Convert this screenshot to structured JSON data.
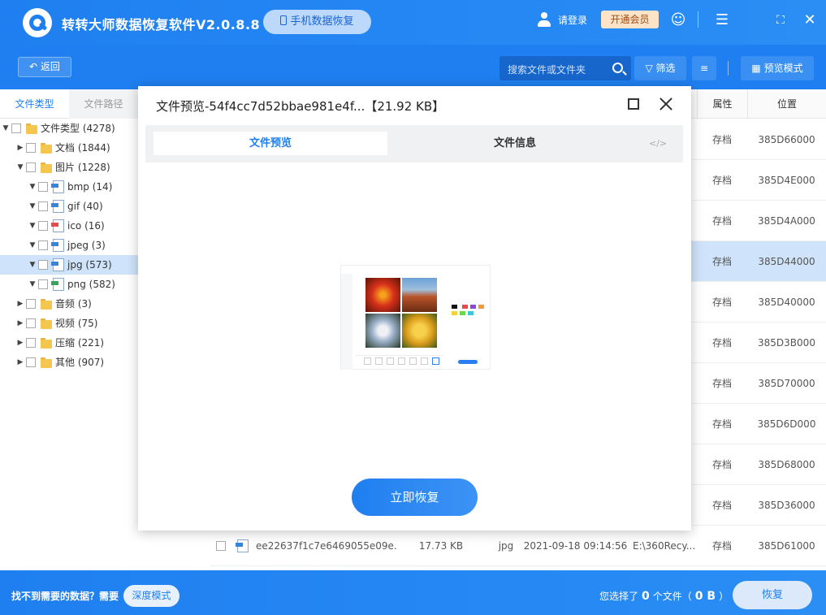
{
  "header": {
    "app_title": "转转大师数据恢复软件V2.0.8.8",
    "mobile_recovery": "手机数据恢复",
    "login": "请登录",
    "vip": "开通会员"
  },
  "toolbar": {
    "back": "返回",
    "search_placeholder": "搜索文件或文件夹",
    "filter": "筛选",
    "preview_mode": "预览模式"
  },
  "left_tabs": {
    "file_type": "文件类型",
    "file_path": "文件路径"
  },
  "tree": [
    {
      "label": "文件类型 (4278)",
      "level": 0,
      "icon": "folder",
      "expanded": true
    },
    {
      "label": "文档 (1844)",
      "level": 1,
      "icon": "folder",
      "expanded": false
    },
    {
      "label": "图片 (1228)",
      "level": 1,
      "icon": "folder",
      "expanded": true
    },
    {
      "label": "bmp (14)",
      "level": 2,
      "icon": "file-blue",
      "expanded": true
    },
    {
      "label": "gif (40)",
      "level": 2,
      "icon": "file-blue",
      "expanded": true
    },
    {
      "label": "ico (16)",
      "level": 2,
      "icon": "file-red",
      "expanded": true
    },
    {
      "label": "jpeg (3)",
      "level": 2,
      "icon": "file-blue",
      "expanded": true
    },
    {
      "label": "jpg (573)",
      "level": 2,
      "icon": "file-blue",
      "expanded": true,
      "selected": true
    },
    {
      "label": "png (582)",
      "level": 2,
      "icon": "file-green",
      "expanded": true
    },
    {
      "label": "音频 (3)",
      "level": 1,
      "icon": "folder",
      "expanded": false
    },
    {
      "label": "视频 (75)",
      "level": 1,
      "icon": "folder",
      "expanded": false
    },
    {
      "label": "压缩 (221)",
      "level": 1,
      "icon": "folder",
      "expanded": false
    },
    {
      "label": "其他 (907)",
      "level": 1,
      "icon": "folder",
      "expanded": false
    }
  ],
  "table": {
    "headers": {
      "attr": "属性",
      "location": "位置"
    },
    "rows": [
      {
        "attr": "存档",
        "location": "385D66000"
      },
      {
        "attr": "存档",
        "location": "385D4E000"
      },
      {
        "attr": "存档",
        "location": "385D4A000"
      },
      {
        "attr": "存档",
        "location": "385D44000",
        "selected": true
      },
      {
        "attr": "存档",
        "location": "385D40000"
      },
      {
        "attr": "存档",
        "location": "385D3B000"
      },
      {
        "attr": "存档",
        "location": "385D70000"
      },
      {
        "attr": "存档",
        "location": "385D6D000"
      },
      {
        "attr": "存档",
        "location": "385D68000"
      },
      {
        "attr": "存档",
        "location": "385D36000"
      },
      {
        "name": "ee22637f1c7e6469055e09e...",
        "size": "17.73 KB",
        "type": "jpg",
        "time": "2021-09-18 09:14:56",
        "path": "E:\\360Recy...",
        "attr": "存档",
        "location": "385D61000"
      }
    ]
  },
  "bottom": {
    "not_found": "找不到需要的数据？需要",
    "deep_mode": "深度模式",
    "selected_prefix": "您选择了",
    "selected_count": "0",
    "selected_mid": "个文件（",
    "selected_size": "0 B",
    "selected_suffix": "）",
    "recover": "恢复"
  },
  "modal": {
    "title": "文件预览-54f4cc7d52bbae981e4f...【21.92 KB】",
    "tab_preview": "文件预览",
    "tab_info": "文件信息",
    "code_icon": "</>",
    "restore_now": "立即恢复"
  }
}
